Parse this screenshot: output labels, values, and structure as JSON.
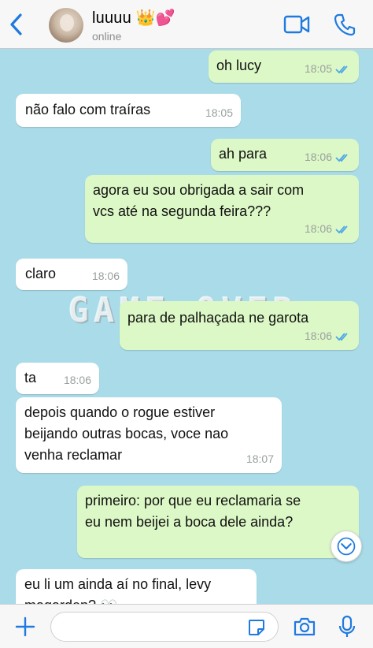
{
  "header": {
    "contact_name": "luuuu 👑💕",
    "status": "online"
  },
  "watermark": "GAME OVER",
  "messages": [
    {
      "direction": "out",
      "text": "oh lucy",
      "time": "18:05",
      "read": true
    },
    {
      "direction": "in",
      "text": "não falo com traíras",
      "time": "18:05"
    },
    {
      "direction": "out",
      "text": "ah para",
      "time": "18:06",
      "read": true
    },
    {
      "direction": "out",
      "text": "agora eu sou obrigada a sair com\nvcs até na segunda feira???",
      "time": "18:06",
      "read": true
    },
    {
      "direction": "in",
      "text": "claro",
      "time": "18:06"
    },
    {
      "direction": "out",
      "text": "para de palhaçada ne garota",
      "time": "18:06",
      "read": true
    },
    {
      "direction": "in",
      "text": "ta",
      "time": "18:06"
    },
    {
      "direction": "in",
      "text": "depois quando o rogue estiver\nbeijando outras bocas, voce nao\nvenha reclamar",
      "time": "18:07"
    },
    {
      "direction": "out",
      "text": "primeiro: por que eu reclamaria se\neu nem beijei a boca dele ainda?",
      "time": "",
      "read": true
    },
    {
      "direction": "in",
      "text": "eu li um ainda aí no final, levy\nmagarden? 👀",
      "time": ""
    }
  ],
  "input": {
    "value": "",
    "placeholder": ""
  },
  "icons": {
    "back": "chevron-left-icon",
    "video": "video-camera-icon",
    "call": "phone-icon",
    "plus": "plus-icon",
    "sticker": "sticker-icon",
    "camera": "camera-icon",
    "mic": "microphone-icon",
    "scroll": "chevron-down-icon"
  },
  "colors": {
    "accent": "#1f7ae0",
    "outgoing_bubble": "#dcf8c6",
    "incoming_bubble": "#ffffff",
    "chat_background": "#a9dbe8",
    "read_ticks": "#4fa8e6"
  }
}
